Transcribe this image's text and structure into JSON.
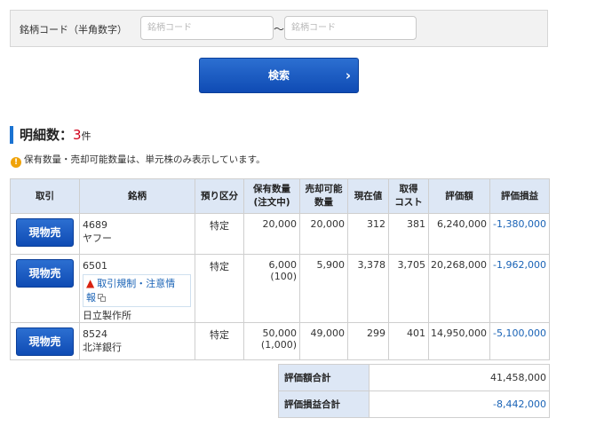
{
  "search": {
    "label": "銘柄コード（半角数字）",
    "from_placeholder": "銘柄コード",
    "to_placeholder": "銘柄コード",
    "from_value": "",
    "to_value": "",
    "separator": "～",
    "button_label": "検索",
    "button_arrow": "›"
  },
  "result": {
    "heading_label": "明細数：",
    "count": "3",
    "unit": "件",
    "note": "保有数量・売却可能数量は、単元株のみ表示しています。",
    "note_icon": "!"
  },
  "table": {
    "headers": {
      "trade": "取引",
      "stock": "銘柄",
      "account_type": "預り区分",
      "holding_qty_1": "保有数量",
      "holding_qty_2": "(注文中)",
      "sellable_1": "売却可能",
      "sellable_2": "数量",
      "price": "現在値",
      "cost_1": "取得",
      "cost_2": "コスト",
      "valuation": "評価額",
      "pnl": "評価損益"
    },
    "rows": [
      {
        "button": "現物売",
        "code": "4689",
        "name": "ヤフー",
        "restriction": "",
        "account_type": "特定",
        "qty": "20,000",
        "qty_pending": "",
        "sellable": "20,000",
        "price": "312",
        "cost": "381",
        "valuation": "6,240,000",
        "pnl": "-1,380,000"
      },
      {
        "button": "現物売",
        "code": "6501",
        "name": "日立製作所",
        "restriction_line1": "取引規制・注意情",
        "restriction_line2": "報",
        "account_type": "特定",
        "qty": "6,000",
        "qty_pending": "(100)",
        "sellable": "5,900",
        "price": "3,378",
        "cost": "3,705",
        "valuation": "20,268,000",
        "pnl": "-1,962,000"
      },
      {
        "button": "現物売",
        "code": "8524",
        "name": "北洋銀行",
        "restriction": "",
        "account_type": "特定",
        "qty": "50,000",
        "qty_pending": "(1,000)",
        "sellable": "49,000",
        "price": "299",
        "cost": "401",
        "valuation": "14,950,000",
        "pnl": "-5,100,000"
      }
    ]
  },
  "totals": {
    "valuation_label": "評価額合計",
    "valuation_value": "41,458,000",
    "pnl_label": "評価損益合計",
    "pnl_value": "-8,442,000"
  },
  "colors": {
    "accent_blue": "#1b73d2",
    "button_blue": "#0f4bb4",
    "negative_text": "#1a63b6",
    "count_red": "#d0001a",
    "warning_orange": "#f0a30a",
    "header_bg": "#dde7f5"
  },
  "icons": {
    "note": "warning-circle-icon",
    "restriction": "warning-triangle-icon",
    "popup": "external-window-icon",
    "search_arrow": "chevron-right-icon"
  }
}
